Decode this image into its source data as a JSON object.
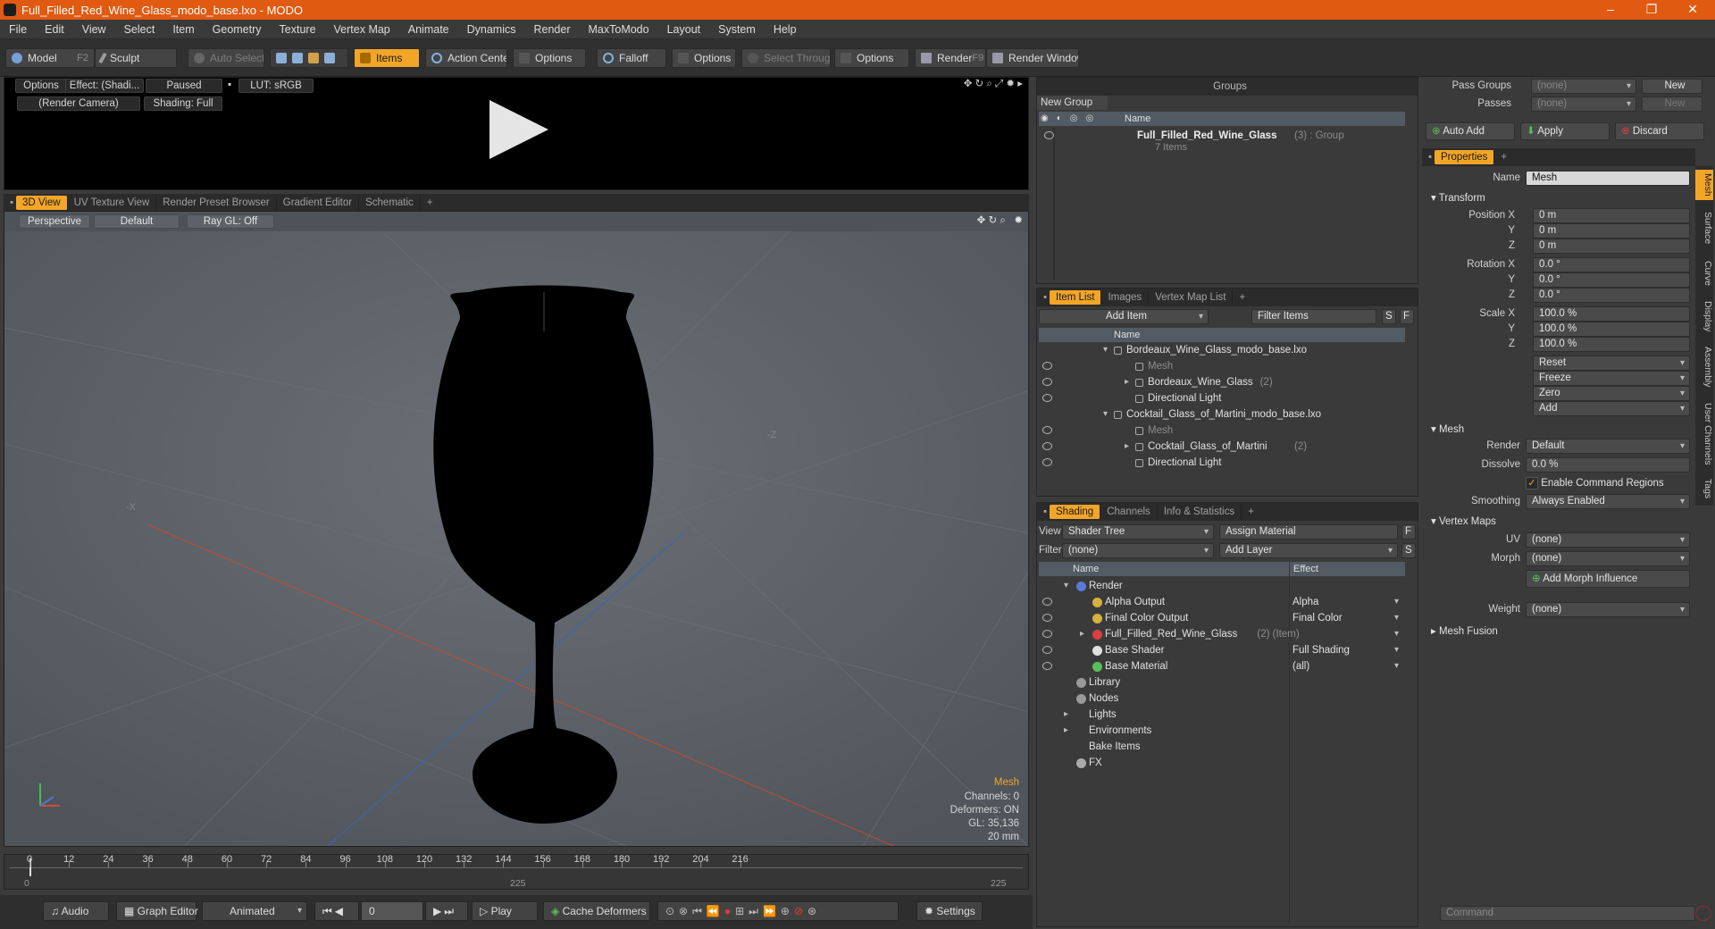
{
  "window": {
    "title": "Full_Filled_Red_Wine_Glass_modo_base.lxo - MODO",
    "minimize": "–",
    "restore": "❐",
    "close": "✕"
  },
  "menu": [
    "File",
    "Edit",
    "View",
    "Select",
    "Item",
    "Geometry",
    "Texture",
    "Vertex Map",
    "Animate",
    "Dynamics",
    "Render",
    "MaxToModo",
    "Layout",
    "System",
    "Help"
  ],
  "toolbar": {
    "model": "Model",
    "model_key": "F2",
    "sculpt": "Sculpt",
    "auto_select": "Auto Select",
    "items": "Items",
    "action_center": "Action Center",
    "options1": "Options",
    "falloff": "Falloff",
    "options2": "Options",
    "select_through": "Select Through",
    "options3": "Options",
    "render": "Render",
    "render_key": "F9",
    "render_window": "Render Window"
  },
  "preview": {
    "options": "Options",
    "effect": "Effect: (Shadi...",
    "paused": "Paused",
    "lut": "LUT: sRGB",
    "camera": "(Render Camera)",
    "shading": "Shading: Full"
  },
  "view_tabs": [
    "3D View",
    "UV Texture View",
    "Render Preset Browser",
    "Gradient Editor",
    "Schematic",
    "+"
  ],
  "viewport": {
    "perspective": "Perspective",
    "default": "Default",
    "raygl": "Ray GL: Off",
    "axis_x": "-X",
    "axis_z": "-Z",
    "hud": {
      "mesh": "Mesh",
      "channels": "Channels: 0",
      "deformers": "Deformers: ON",
      "gl": "GL: 35,136",
      "mm": "20 mm"
    }
  },
  "timeline": {
    "ticks": [
      "0",
      "12",
      "24",
      "36",
      "48",
      "60",
      "72",
      "84",
      "96",
      "108",
      "120",
      "132",
      "144",
      "156",
      "168",
      "180",
      "192",
      "204",
      "216"
    ],
    "start": "0",
    "mid": "225",
    "end": "225"
  },
  "bottom": {
    "audio": "Audio",
    "graph_editor": "Graph Editor",
    "animated": "Animated",
    "frame": "0",
    "play": "Play",
    "cache": "Cache Deformers",
    "settings": "Settings"
  },
  "groups": {
    "title": "Groups",
    "new_group": "New Group",
    "col_name": "Name",
    "item_name": "Full_Filled_Red_Wine_Glass",
    "item_meta": "(3) : Group",
    "item_sub": "7 Items"
  },
  "itemlist": {
    "tabs": [
      "Item List",
      "Images",
      "Vertex Map List",
      "+"
    ],
    "add_item": "Add Item",
    "filter": "Filter Items",
    "s": "S",
    "f": "F",
    "col_name": "Name",
    "rows": [
      {
        "text": "Bordeaux_Wine_Glass_modo_base.lxo",
        "meta": ""
      },
      {
        "text": "Mesh",
        "meta": ""
      },
      {
        "text": "Bordeaux_Wine_Glass",
        "meta": "(2)"
      },
      {
        "text": "Directional Light",
        "meta": ""
      },
      {
        "text": "Cocktail_Glass_of_Martini_modo_base.lxo",
        "meta": ""
      },
      {
        "text": "Mesh",
        "meta": ""
      },
      {
        "text": "Cocktail_Glass_of_Martini",
        "meta": "(2)"
      },
      {
        "text": "Directional Light",
        "meta": ""
      }
    ]
  },
  "shading": {
    "tabs": [
      "Shading",
      "Channels",
      "Info & Statistics",
      "+"
    ],
    "view_label": "View",
    "view_value": "Shader Tree",
    "assign": "Assign Material",
    "f": "F",
    "filter_label": "Filter",
    "filter_value": "(none)",
    "add_layer": "Add Layer",
    "s": "S",
    "col_name": "Name",
    "col_effect": "Effect",
    "rows": [
      {
        "name": "Render",
        "effect": "",
        "meta": ""
      },
      {
        "name": "Alpha Output",
        "effect": "Alpha",
        "meta": ""
      },
      {
        "name": "Final Color Output",
        "effect": "Final Color",
        "meta": ""
      },
      {
        "name": "Full_Filled_Red_Wine_Glass",
        "effect": "",
        "meta": "(2) (Item)"
      },
      {
        "name": "Base Shader",
        "effect": "Full Shading",
        "meta": ""
      },
      {
        "name": "Base Material",
        "effect": "(all)",
        "meta": ""
      },
      {
        "name": "Library",
        "effect": "",
        "meta": ""
      },
      {
        "name": "Nodes",
        "effect": "",
        "meta": ""
      },
      {
        "name": "Lights",
        "effect": "",
        "meta": ""
      },
      {
        "name": "Environments",
        "effect": "",
        "meta": ""
      },
      {
        "name": "Bake Items",
        "effect": "",
        "meta": ""
      },
      {
        "name": "FX",
        "effect": "",
        "meta": ""
      }
    ]
  },
  "props": {
    "pass_groups": "Pass Groups",
    "pass_groups_val": "(none)",
    "new": "New",
    "passes": "Passes",
    "passes_val": "(none)",
    "new2": "New",
    "auto_add": "Auto Add",
    "apply": "Apply",
    "discard": "Discard",
    "tab": "Properties",
    "plus": "+",
    "name_label": "Name",
    "name_val": "Mesh",
    "transform": "Transform",
    "pos_label": "Position X",
    "rot_label": "Rotation X",
    "scale_label": "Scale X",
    "y": "Y",
    "z": "Z",
    "pos": [
      "0 m",
      "0 m",
      "0 m"
    ],
    "rot": [
      "0.0 °",
      "0.0 °",
      "0.0 °"
    ],
    "scale": [
      "100.0 %",
      "100.0 %",
      "100.0 %"
    ],
    "reset": "Reset",
    "freeze": "Freeze",
    "zero": "Zero",
    "add": "Add",
    "mesh": "Mesh",
    "render_label": "Render",
    "render_val": "Default",
    "dissolve_label": "Dissolve",
    "dissolve_val": "0.0 %",
    "enable_cmd": "Enable Command Regions",
    "smoothing_label": "Smoothing",
    "smoothing_val": "Always Enabled",
    "vertex_maps": "Vertex Maps",
    "uv_label": "UV",
    "uv_val": "(none)",
    "morph_label": "Morph",
    "morph_val": "(none)",
    "add_morph": "Add Morph Influence",
    "weight_label": "Weight",
    "weight_val": "(none)",
    "mesh_fusion": "Mesh Fusion",
    "vtabs": [
      "Mesh",
      "Surface",
      "Curve",
      "Display",
      "Assembly",
      "User Channels",
      "Tags"
    ],
    "command": "Command"
  },
  "colors": {
    "accent": "#f2a527",
    "titlebar": "#e05a12"
  }
}
